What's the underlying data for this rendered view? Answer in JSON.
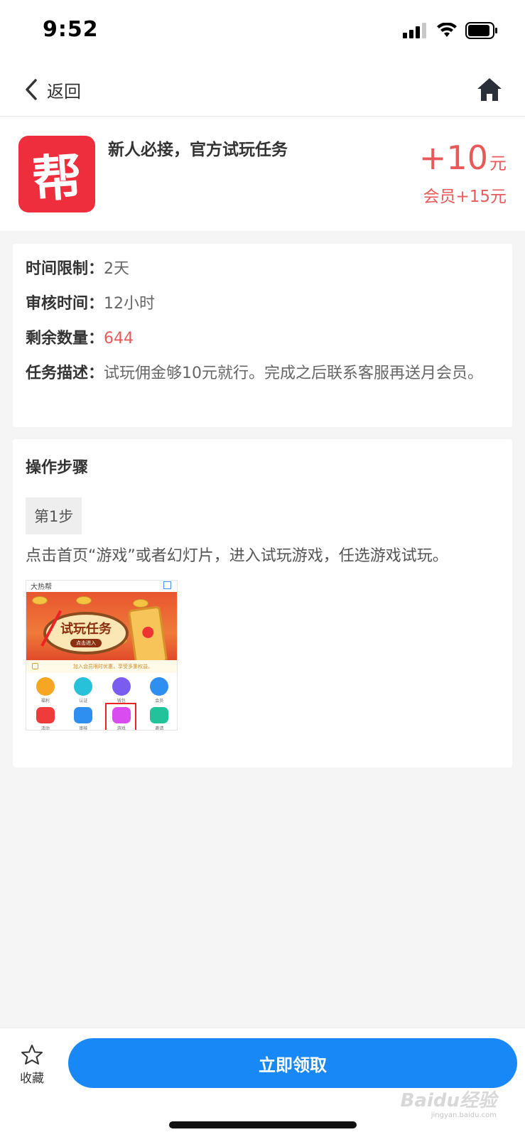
{
  "status_bar": {
    "time": "9:52"
  },
  "nav": {
    "back_label": "返回"
  },
  "task": {
    "logo_char": "帮",
    "title": "新人必接，官方试玩任务",
    "reward_amount": "+10",
    "reward_unit": "元",
    "member_reward": "会员+15元"
  },
  "info": {
    "time_limit_label": "时间限制：",
    "time_limit_value": "2天",
    "review_time_label": "审核时间：",
    "review_time_value": "12小时",
    "remaining_label": "剩余数量：",
    "remaining_value": "644",
    "desc_label": "任务描述：",
    "desc_value": "试玩佣金够10元就行。完成之后联系客服再送月会员。"
  },
  "steps": {
    "title": "操作步骤",
    "items": [
      {
        "badge": "第1步",
        "text": "点击首页“游戏”或者幻灯片，进入试玩游戏，任选游戏试玩。",
        "screenshot": {
          "app_name": "大热帮",
          "banner_title": "试玩任务",
          "banner_button": "点击进入",
          "notice": "加入会员限时优惠，享受多重权益。",
          "icons": [
            {
              "label": "福利",
              "color": "#f5a623"
            },
            {
              "label": "认证",
              "color": "#27c2d9"
            },
            {
              "label": "钱包",
              "color": "#7b5cf0"
            },
            {
              "label": "会员",
              "color": "#2f8ff0"
            },
            {
              "label": "活动",
              "color": "#ef3b3b"
            },
            {
              "label": "审核",
              "color": "#2f8ff0"
            },
            {
              "label": "游戏",
              "color": "#d94df0"
            },
            {
              "label": "邀请",
              "color": "#22c29a"
            }
          ]
        }
      }
    ]
  },
  "bottom": {
    "favorite_label": "收藏",
    "claim_label": "立即领取"
  },
  "watermark": {
    "brand": "Baidu经验",
    "url": "jingyan.baidu.com"
  },
  "colors": {
    "accent": "#1788f5",
    "reward": "#e85a5a",
    "logo_bg": "#ee2e3d"
  }
}
